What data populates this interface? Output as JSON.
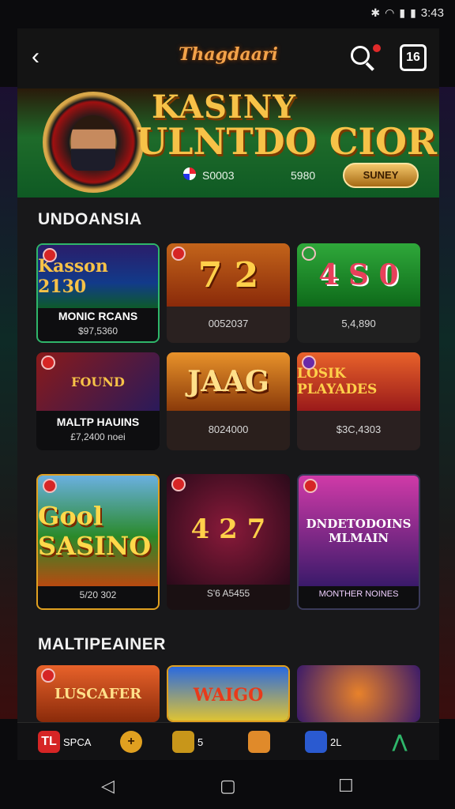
{
  "status_bar": {
    "time": "3:43"
  },
  "header": {
    "logo": "Thagdaari",
    "back_glyph": "‹",
    "menu_label": "16"
  },
  "banner": {
    "title_line1": "KASINY",
    "title_line2": "ULNTDO CIORS",
    "value1": "S0003",
    "value2": "5980",
    "button_label": "SUNEY"
  },
  "sections": [
    {
      "title": "UNDOANSIA"
    },
    {
      "title": "MALTIPEAINER"
    }
  ],
  "row1": [
    {
      "art": "Kasson 2130",
      "label": "MONIC RCANS",
      "amount": "$97,5360"
    },
    {
      "art": "7 2",
      "label": "",
      "amount": "0052037"
    },
    {
      "art": "4 S 0",
      "label": "",
      "amount": "5,4,890"
    }
  ],
  "row2": [
    {
      "art": "FOUND",
      "label": "MALTP HAUINS",
      "amount": "£7,2400 noei"
    },
    {
      "art": "JAAG",
      "label": "",
      "amount": "8024000"
    },
    {
      "art": "LOSIK PLAYADES",
      "label": "",
      "amount": "$3C,4303"
    }
  ],
  "row3": [
    {
      "art": "Gool SASINO",
      "label": "",
      "amount": "5/20 302"
    },
    {
      "art": "4 2 7",
      "label": "",
      "amount": "S'6 A5455"
    },
    {
      "art": "DNDETODOINS MLMAIN",
      "label": "",
      "amount": "MONTHER NOINES"
    }
  ],
  "row4": [
    {
      "art": "LUSCAFER"
    },
    {
      "art": "WAIGO"
    },
    {
      "art": ""
    }
  ],
  "bottom_nav": [
    {
      "icon": "TL",
      "label": "SPCA"
    },
    {
      "icon": "+",
      "label": ""
    },
    {
      "icon": "",
      "label": "5"
    },
    {
      "icon": "",
      "label": ""
    },
    {
      "icon": "",
      "label": "2L"
    },
    {
      "icon": "",
      "label": ""
    }
  ],
  "system_nav": {
    "back": "◁",
    "home": "▢",
    "recents": "☐"
  },
  "colors": {
    "accent_gold": "#f7c248",
    "bg": "#18181a",
    "badge_red": "#d62525"
  }
}
